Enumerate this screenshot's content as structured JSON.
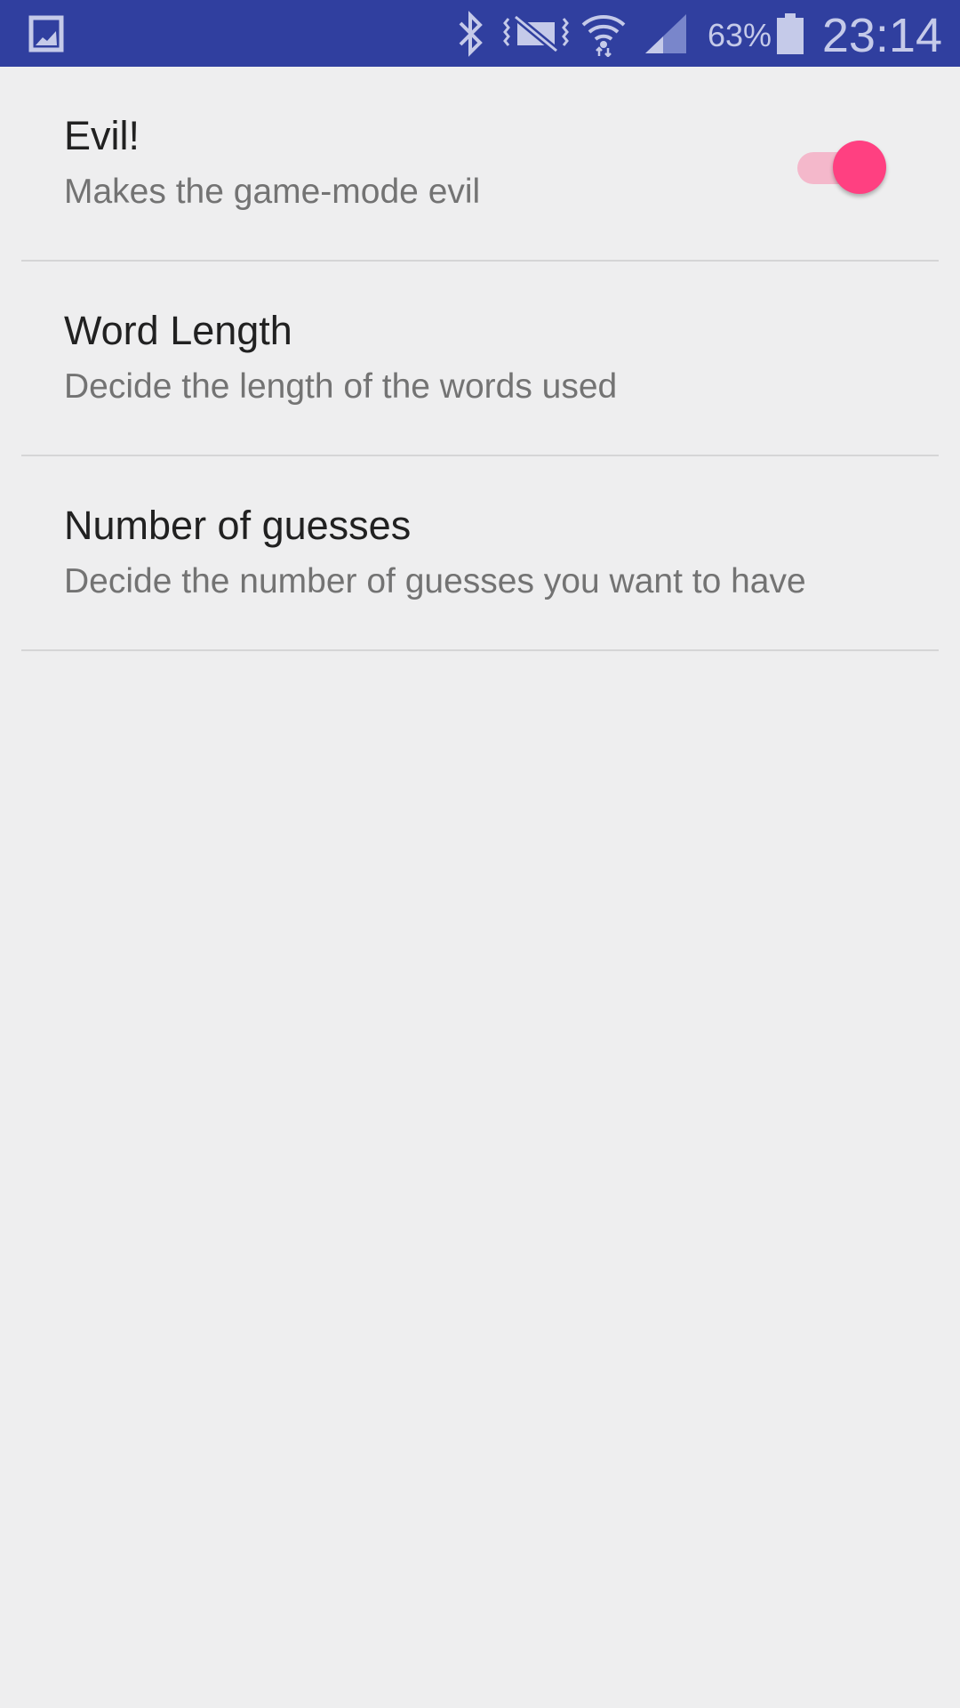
{
  "status_bar": {
    "battery_percent": "63%",
    "time": "23:14",
    "icons": [
      "gallery-icon",
      "bluetooth-icon",
      "vibrate-mute-icon",
      "wifi-icon",
      "cell-signal-icon",
      "battery-icon"
    ],
    "background_color": "#303f9f",
    "icon_color": "#c5cae9"
  },
  "preferences": [
    {
      "title": "Evil!",
      "summary": "Makes the game-mode evil",
      "has_switch": true,
      "switch_on": true
    },
    {
      "title": "Word Length",
      "summary": "Decide the length of the words used"
    },
    {
      "title": "Number of guesses",
      "summary": "Decide the number of guesses you want to have"
    }
  ],
  "colors": {
    "background": "#eeeeef",
    "accent": "#ff4081",
    "switch_track_on": "#f4b8cb",
    "title_text": "#212121",
    "summary_text": "#737373",
    "divider": "#d5d5d6"
  }
}
